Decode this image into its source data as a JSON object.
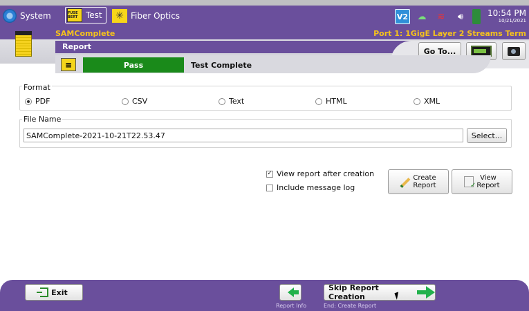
{
  "topbar": {
    "tabs": [
      {
        "label": "System",
        "icon": "gear-icon"
      },
      {
        "label": "Test",
        "icon": "bert-icon",
        "icon_text": "FUSE BERT"
      },
      {
        "label": "Fiber Optics",
        "icon": "fiber-icon"
      }
    ],
    "status": {
      "v2_label": "V2",
      "time": "10:54 PM",
      "date": "10/21/2021"
    }
  },
  "header": {
    "app_name": "SAMComplete",
    "port_info": "Port 1: 1GigE Layer 2 Streams Term",
    "page_title": "Report",
    "goto_label": "Go To..."
  },
  "status_strip": {
    "result": "Pass",
    "state": "Test Complete",
    "result_color": "#1a8a1a"
  },
  "form": {
    "format_label": "Format",
    "formats": [
      "PDF",
      "CSV",
      "Text",
      "HTML",
      "XML"
    ],
    "selected_format": "PDF",
    "file_name_label": "File Name",
    "file_name": "SAMComplete-2021-10-21T22.53.47",
    "select_label": "Select...",
    "view_after_label": "View report after creation",
    "view_after_checked": true,
    "include_log_label": "Include message log",
    "include_log_checked": false,
    "create_report_line1": "Create",
    "create_report_line2": "Report",
    "view_report_line1": "View",
    "view_report_line2": "Report"
  },
  "footer": {
    "exit_label": "Exit",
    "skip_label": "Skip Report Creation",
    "back_caption": "Report Info",
    "next_caption": "End: Create Report"
  },
  "colors": {
    "brand_purple": "#6a4f9c",
    "accent_yellow": "#f5c21c",
    "arrow_green": "#22b14c"
  }
}
